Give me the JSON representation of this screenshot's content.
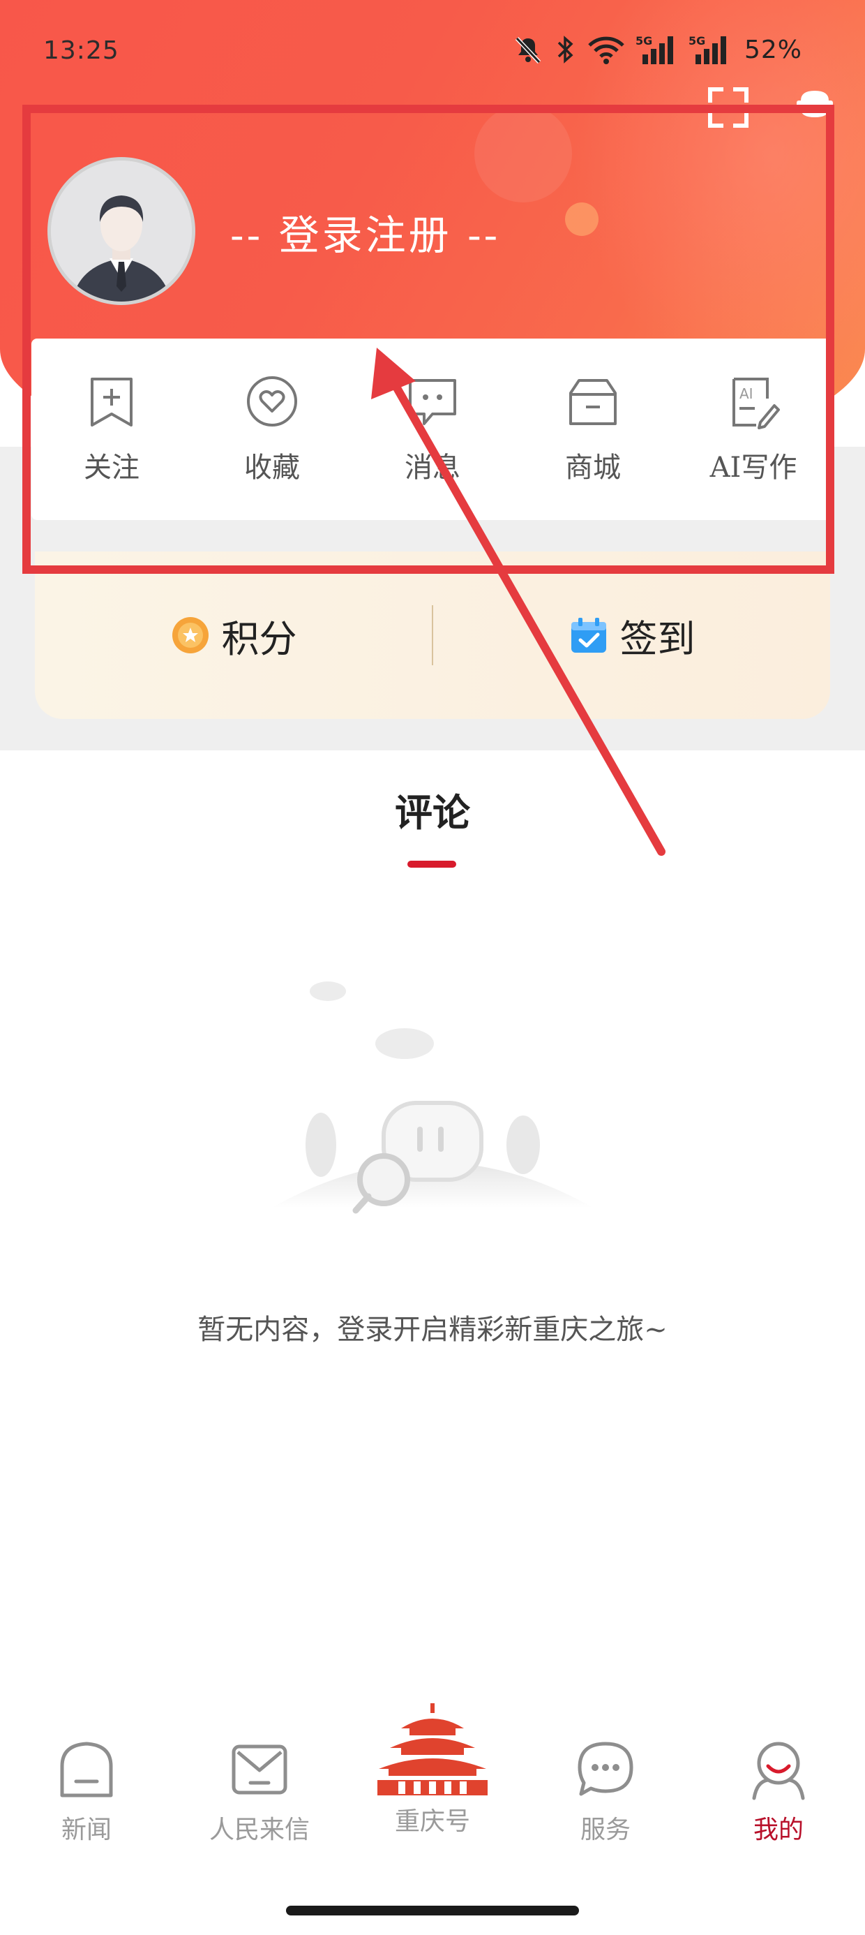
{
  "status_bar": {
    "time": "13:25",
    "battery": "52%",
    "signal_labels": [
      "5G",
      "5G"
    ]
  },
  "header": {
    "login_text": "-- 登录注册 --"
  },
  "quick_actions": [
    {
      "label": "关注",
      "icon": "bookmark-add-icon"
    },
    {
      "label": "收藏",
      "icon": "heart-icon"
    },
    {
      "label": "消息",
      "icon": "message-icon"
    },
    {
      "label": "商城",
      "icon": "store-box-icon"
    },
    {
      "label": "AI写作",
      "icon": "ai-writing-icon"
    }
  ],
  "points": {
    "points_label": "积分",
    "checkin_label": "签到"
  },
  "tabs": {
    "comment": "评论"
  },
  "empty_state": {
    "message": "暂无内容，登录开启精彩新重庆之旅~"
  },
  "bottom_nav": [
    {
      "label": "新闻",
      "icon": "news-home-icon"
    },
    {
      "label": "人民来信",
      "icon": "mail-icon"
    },
    {
      "label": "重庆号",
      "icon": "temple-icon"
    },
    {
      "label": "服务",
      "icon": "chat-bubble-icon"
    },
    {
      "label": "我的",
      "icon": "profile-icon",
      "active": true
    }
  ],
  "colors": {
    "header_red": "#f8574a",
    "accent_red": "#d81b2c",
    "nav_active": "#b8102a",
    "annotation_red": "#e53b3f"
  }
}
